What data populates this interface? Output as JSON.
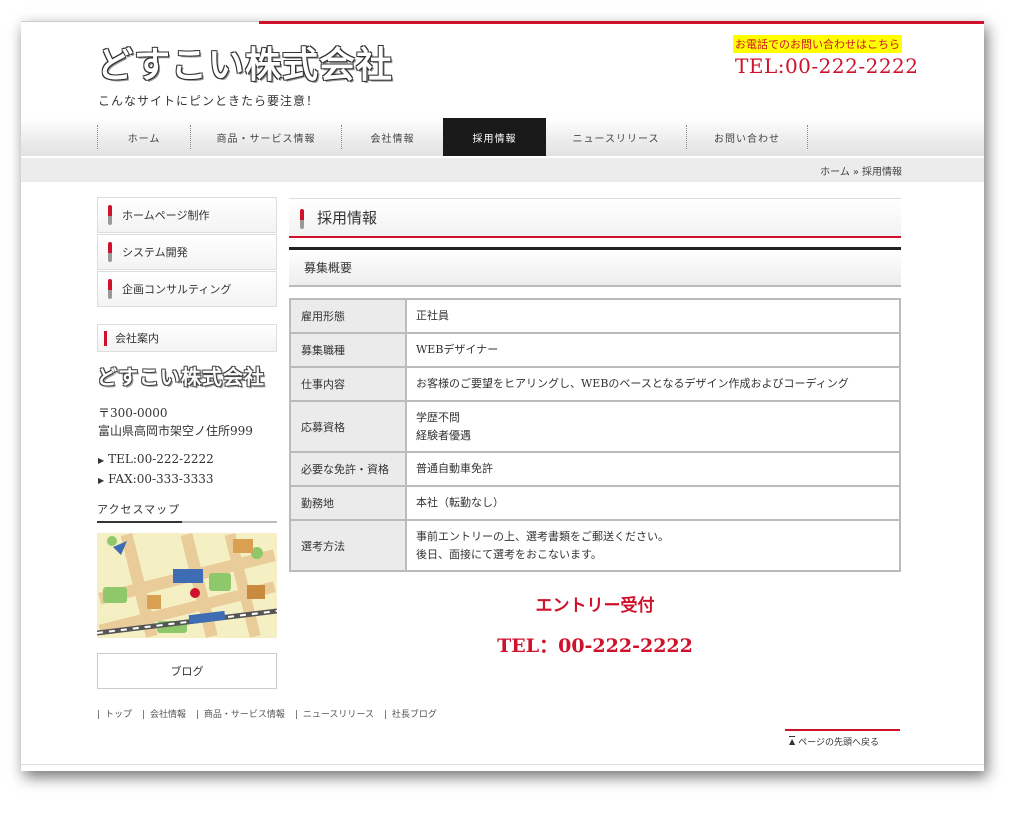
{
  "header": {
    "logo": "どすこい株式会社",
    "tagline": "こんなサイトにピンときたら要注意！",
    "phone_label": "お電話でのお問い合わせはこちら",
    "phone": "TEL:00-222-2222"
  },
  "nav": {
    "items": [
      {
        "label": "ホーム"
      },
      {
        "label": "商品・サービス情報"
      },
      {
        "label": "会社情報"
      },
      {
        "label": "採用情報"
      },
      {
        "label": "ニュースリリース"
      },
      {
        "label": "お問い合わせ"
      }
    ],
    "active": "採用情報"
  },
  "breadcrumb": {
    "home": "ホーム",
    "separator": "»",
    "current": "採用情報"
  },
  "sidebar": {
    "menu": [
      {
        "label": "ホームページ制作"
      },
      {
        "label": "システム開発"
      },
      {
        "label": "企画コンサルティング"
      }
    ],
    "company_heading": "会社案内",
    "company_logo": "どすこい株式会社",
    "postal": "〒300-0000",
    "address": "富山県高岡市架空ノ住所999",
    "tel": "TEL:00-222-2222",
    "fax": "FAX:00-333-3333",
    "map_title": "アクセスマップ",
    "blog": "ブログ"
  },
  "main": {
    "title": "採用情報",
    "subtitle": "募集概要",
    "table": [
      {
        "label": "雇用形態",
        "value": [
          "正社員"
        ]
      },
      {
        "label": "募集職種",
        "value": [
          "WEBデザイナー"
        ]
      },
      {
        "label": "仕事内容",
        "value": [
          "お客様のご要望をヒアリングし、WEBのベースとなるデザイン作成およびコーディング"
        ]
      },
      {
        "label": "応募資格",
        "value": [
          "学歴不問",
          "経験者優遇"
        ]
      },
      {
        "label": "必要な免許・資格",
        "value": [
          "普通自動車免許"
        ]
      },
      {
        "label": "勤務地",
        "value": [
          "本社（転勤なし）"
        ]
      },
      {
        "label": "選考方法",
        "value": [
          "事前エントリーの上、選考書類をご郵送ください。",
          "後日、面接にて選考をおこないます。"
        ]
      }
    ],
    "entry": "エントリー受付",
    "entry_tel": "TEL：00-222-2222"
  },
  "footer": {
    "links": [
      {
        "label": "トップ"
      },
      {
        "label": "会社情報"
      },
      {
        "label": "商品・サービス情報"
      },
      {
        "label": "ニュースリリース"
      },
      {
        "label": "社長ブログ"
      }
    ],
    "pagetop": "ページの先頭へ戻る"
  },
  "colors": {
    "accent": "#d0112b",
    "nav_active": "#1a1a1a",
    "phone_highlight": "#ffff00"
  }
}
